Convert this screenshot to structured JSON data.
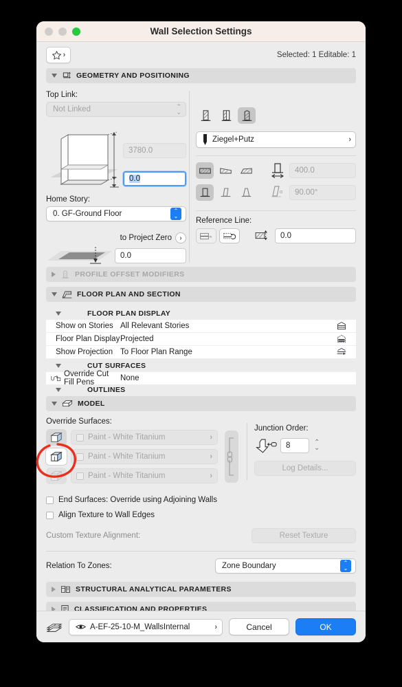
{
  "window": {
    "title": "Wall Selection Settings",
    "traffic_lights": [
      "close-red",
      "minimize-amber",
      "maximize-green"
    ]
  },
  "header": {
    "favorites_icon": "star-icon",
    "favorites_chevron": "›",
    "selection_status": "Selected: 1 Editable: 1"
  },
  "sections": {
    "geometry": {
      "title": "GEOMETRY AND POSITIONING",
      "icon": "geometry-positioning-icon",
      "expanded": true,
      "top_link_label": "Top Link:",
      "top_link_value": "Not Linked",
      "top_link_disabled": true,
      "height_value": "3780.0",
      "height_disabled": true,
      "base_offset_value": "0.0",
      "base_offset_focused": true,
      "home_story_label": "Home Story:",
      "home_story_value": "0. GF-Ground Floor",
      "to_project_zero_label": "to Project Zero",
      "to_project_zero_chevron": "›",
      "project_zero_value": "0.0",
      "structure_types": [
        "basic-wall-icon",
        "complex-profile-icon",
        "composite-wall-icon"
      ],
      "structure_selected_index": 2,
      "composite_icon": "pen-attribute-icon",
      "composite_name": "Ziegel+Putz",
      "composite_chevron": "›",
      "geometry_methods": [
        "straight-wall-icon",
        "trapezoid-wall-icon",
        "polygon-wall-icon"
      ],
      "geometry_method_selected_index": 0,
      "thickness_icon": "wall-thickness-icon",
      "thickness_value": "400.0",
      "thickness_disabled": true,
      "inclination_types": [
        "vertical-wall-icon",
        "slanted-wall-icon",
        "double-slanted-wall-icon"
      ],
      "inclination_selected_index": 0,
      "angle_icon": "wall-angle-icon",
      "angle_value": "90.00°",
      "angle_disabled": true,
      "reference_line_label": "Reference Line:",
      "ref_line_buttons": [
        "reference-line-location-icon",
        "flip-reference-line-icon"
      ],
      "ref_offset_icon": "reference-line-offset-icon",
      "ref_offset_value": "0.0"
    },
    "profile_offset": {
      "title": "PROFILE OFFSET MODIFIERS",
      "icon": "profile-offset-icon",
      "expanded": false,
      "disabled": true
    },
    "floor_plan": {
      "title": "FLOOR PLAN AND SECTION",
      "icon": "floor-plan-section-icon",
      "expanded": true,
      "groups": [
        {
          "name": "FLOOR PLAN DISPLAY",
          "rows": [
            {
              "label": "Show on Stories",
              "value": "All Relevant Stories",
              "icon": "show-on-stories-icon",
              "row_icon": ""
            },
            {
              "label": "Floor Plan Display",
              "value": "Projected",
              "icon": "floor-plan-display-icon",
              "row_icon": ""
            },
            {
              "label": "Show Projection",
              "value": "To Floor Plan Range",
              "icon": "show-projection-icon",
              "row_icon": ""
            }
          ]
        },
        {
          "name": "CUT SURFACES",
          "rows": [
            {
              "label": "Override Cut Fill Pens",
              "value": "None",
              "icon": "",
              "row_icon": "override-cut-fill-pens-icon"
            }
          ]
        },
        {
          "name": "OUTLINES",
          "rows": []
        }
      ]
    },
    "model": {
      "title": "MODEL",
      "icon": "model-3d-icon",
      "expanded": true,
      "override_surfaces_label": "Override Surfaces:",
      "surfaces": [
        {
          "icon": "outside-surface-icon",
          "material": "Paint - White Titanium",
          "chevron": "›",
          "state": "gray",
          "checked": false
        },
        {
          "icon": "edge-surface-icon",
          "material": "Paint - White Titanium",
          "chevron": "›",
          "state": "selected",
          "checked": false
        },
        {
          "icon": "inside-surface-icon",
          "material": "Paint - White Titanium",
          "chevron": "›",
          "state": "disabled",
          "checked": false
        }
      ],
      "link_icon": "link-surfaces-icon",
      "junction_order_label": "Junction Order:",
      "junction_order_icon": "junction-order-icon",
      "junction_order_value": "8",
      "junction_stepper": "stepper-icon",
      "log_details_label": "Log Details...",
      "log_details_disabled": true,
      "end_surfaces_label": "End Surfaces: Override using Adjoining Walls",
      "end_surfaces_checked": false,
      "align_texture_label": "Align Texture to Wall Edges",
      "align_texture_checked": false,
      "custom_texture_label": "Custom Texture Alignment:",
      "reset_texture_label": "Reset Texture",
      "reset_texture_disabled": true,
      "relation_to_zones_label": "Relation To Zones:",
      "relation_to_zones_value": "Zone Boundary"
    },
    "structural": {
      "title": "STRUCTURAL ANALYTICAL PARAMETERS",
      "icon": "structural-analytical-icon",
      "expanded": false
    },
    "classification": {
      "title": "CLASSIFICATION AND PROPERTIES",
      "icon": "classification-properties-icon",
      "expanded": false
    }
  },
  "footer": {
    "layer_icon": "layers-icon",
    "layer_eye_icon": "eye-icon",
    "layer_name": "A-EF-25-10-M_WallsInternal",
    "layer_chevron": "›",
    "cancel_label": "Cancel",
    "ok_label": "OK"
  },
  "annotation": {
    "type": "red-ellipse-highlight",
    "color": "#e8301e",
    "target": "edge-surface-icon"
  },
  "colors": {
    "titlebar": "#f7eeea",
    "window_bg": "#ececec",
    "accent_blue": "#1b7ef5",
    "section_header": "#dcdcdc",
    "annotation_red": "#e8301e"
  }
}
